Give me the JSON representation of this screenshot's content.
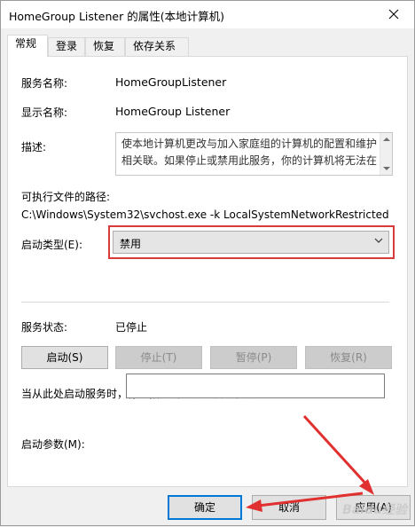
{
  "window": {
    "title": "HomeGroup Listener 的属性(本地计算机)"
  },
  "tabs": [
    {
      "label": "常规"
    },
    {
      "label": "登录"
    },
    {
      "label": "恢复"
    },
    {
      "label": "依存关系"
    }
  ],
  "general": {
    "service_name_label": "服务名称:",
    "service_name_value": "HomeGroupListener",
    "display_name_label": "显示名称:",
    "display_name_value": "HomeGroup Listener",
    "description_label": "描述:",
    "description_text": "使本地计算机更改与加入家庭组的计算机的配置和维护相关联。如果停止或禁用此服务，你的计算机将无法在",
    "exe_path_label": "可执行文件的路径:",
    "exe_path_value": "C:\\Windows\\System32\\svchost.exe -k LocalSystemNetworkRestricted",
    "startup_type_label": "启动类型(E):",
    "startup_type_value": "禁用",
    "service_status_label": "服务状态:",
    "service_status_value": "已停止",
    "buttons": {
      "start": "启动(S)",
      "stop": "停止(T)",
      "pause": "暂停(P)",
      "resume": "恢复(R)"
    },
    "hint_text": "当从此处启动服务时，你可指定所适用的启动参数。",
    "start_params_label": "启动参数(M):",
    "start_params_value": ""
  },
  "dialog_buttons": {
    "ok": "确定",
    "cancel": "取消",
    "apply": "应用(A)"
  },
  "watermark": "Baidu经验",
  "colors": {
    "annotation_red": "#d93a3a",
    "focus_blue": "#0078d7"
  }
}
